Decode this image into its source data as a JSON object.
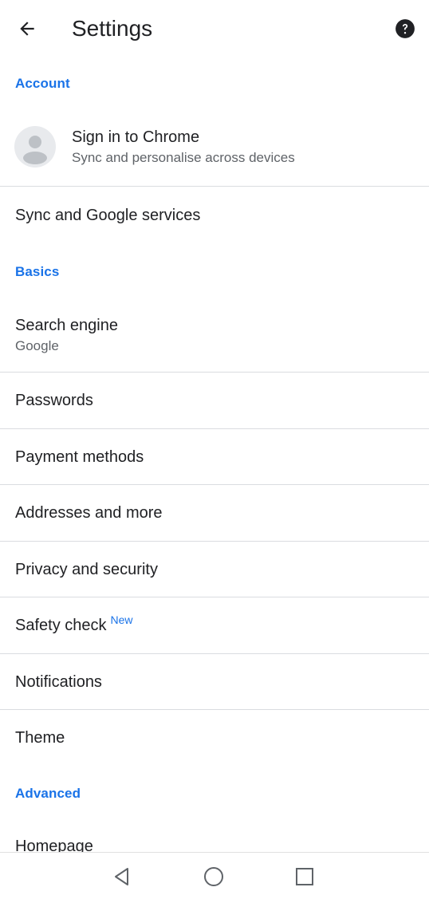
{
  "header": {
    "title": "Settings",
    "back_icon": "arrow-back-icon",
    "help_icon": "help-icon"
  },
  "sections": {
    "account": "Account",
    "basics": "Basics",
    "advanced": "Advanced"
  },
  "account": {
    "title": "Sign in to Chrome",
    "subtitle": "Sync and personalise across devices",
    "avatar_icon": "person-avatar-icon"
  },
  "items": {
    "sync": "Sync and Google services",
    "search_engine": "Search engine",
    "search_engine_value": "Google",
    "passwords": "Passwords",
    "payment_methods": "Payment methods",
    "addresses": "Addresses and more",
    "privacy": "Privacy and security",
    "safety_check": "Safety check",
    "safety_check_badge": "New",
    "notifications": "Notifications",
    "theme": "Theme",
    "homepage": "Homepage"
  },
  "colors": {
    "accent": "#1a73e8",
    "text_primary": "#202124",
    "text_secondary": "#5f6368",
    "divider": "#dadce0"
  },
  "navbar": {
    "back_icon": "triangle-back-icon",
    "home_icon": "circle-home-icon",
    "recents_icon": "square-recents-icon"
  }
}
